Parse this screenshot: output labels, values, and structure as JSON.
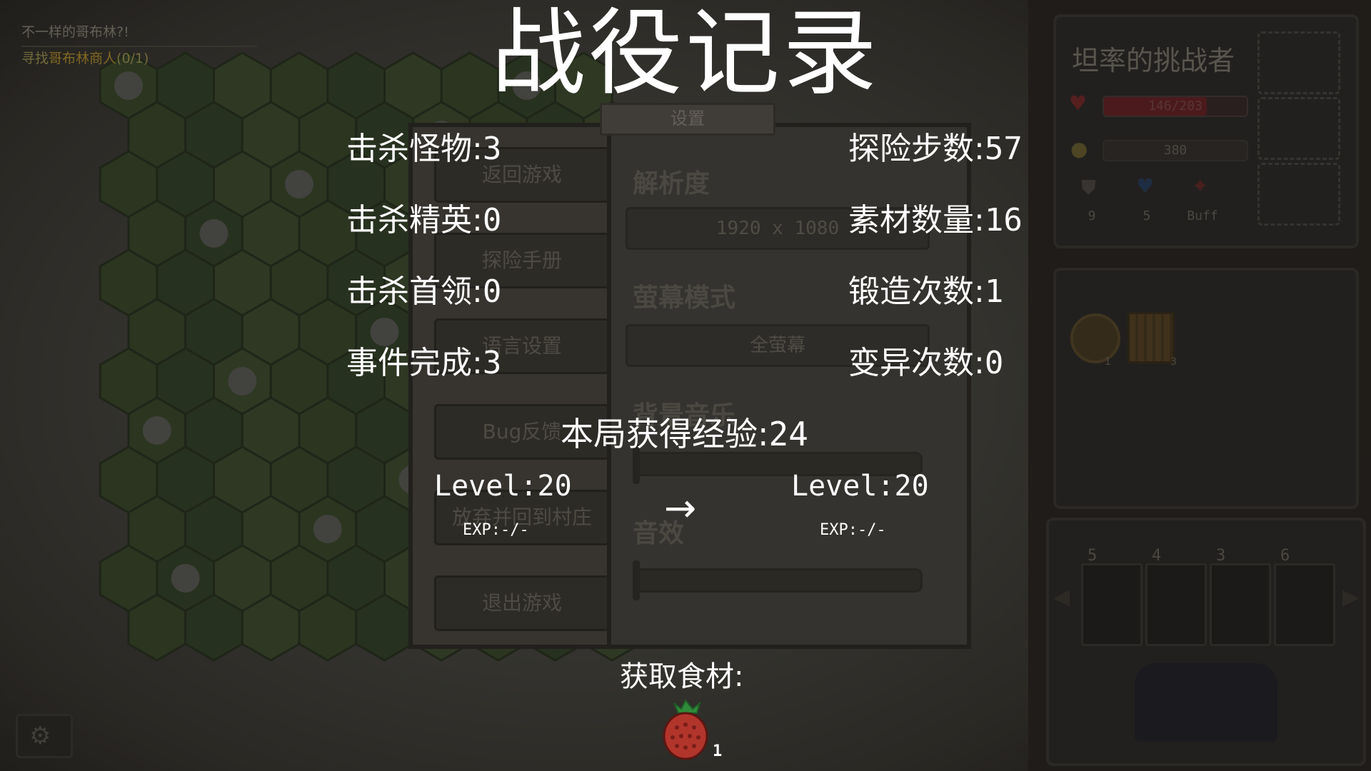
{
  "world": {
    "quest_title": "不一样的哥布林?!",
    "quest_objective_prefix": "寻找",
    "quest_objective_target": "哥布林商人",
    "quest_objective_progress": "(0/1)"
  },
  "character": {
    "name": "坦率的挑战者",
    "hp_text": "146/203",
    "hp_fraction": 0.72,
    "gold": "380",
    "armor": "9",
    "shield": "5",
    "buff_label": "Buff"
  },
  "bag": {
    "item1_count": "1",
    "item2_count": "3"
  },
  "skills": [
    "5",
    "4",
    "3",
    "6"
  ],
  "settings_menu": {
    "tab_label": "设置",
    "buttons": [
      "返回游戏",
      "探险手册",
      "语言设置",
      "Bug反馈",
      "放弃并回到村庄",
      "退出游戏"
    ],
    "resolution_label": "解析度",
    "resolution_value": "1920 x 1080",
    "screen_mode_label": "萤幕模式",
    "screen_mode_value": "全萤幕",
    "bgm_label": "背景音乐",
    "sfx_label": "音效"
  },
  "result": {
    "title": "战役记录",
    "stats_left": [
      {
        "label": "击杀怪物:",
        "value": "3"
      },
      {
        "label": "击杀精英:",
        "value": "0"
      },
      {
        "label": "击杀首领:",
        "value": "0"
      },
      {
        "label": "事件完成:",
        "value": "3"
      }
    ],
    "stats_right": [
      {
        "label": "探险步数:",
        "value": "57"
      },
      {
        "label": "素材数量:",
        "value": "16"
      },
      {
        "label": "锻造次数:",
        "value": "1"
      },
      {
        "label": "变异次数:",
        "value": "0"
      }
    ],
    "exp_gain_label": "本局获得经验:",
    "exp_gain_value": "24",
    "level_before": "Level:20",
    "exp_before": "EXP:-/-",
    "arrow": "→",
    "level_after": "Level:20",
    "exp_after": "EXP:-/-",
    "ingredients_label": "获取食材:",
    "ingredient_count": "1"
  },
  "colors": {
    "hp_red": "#8a2a2c",
    "gold": "#b8962e"
  }
}
